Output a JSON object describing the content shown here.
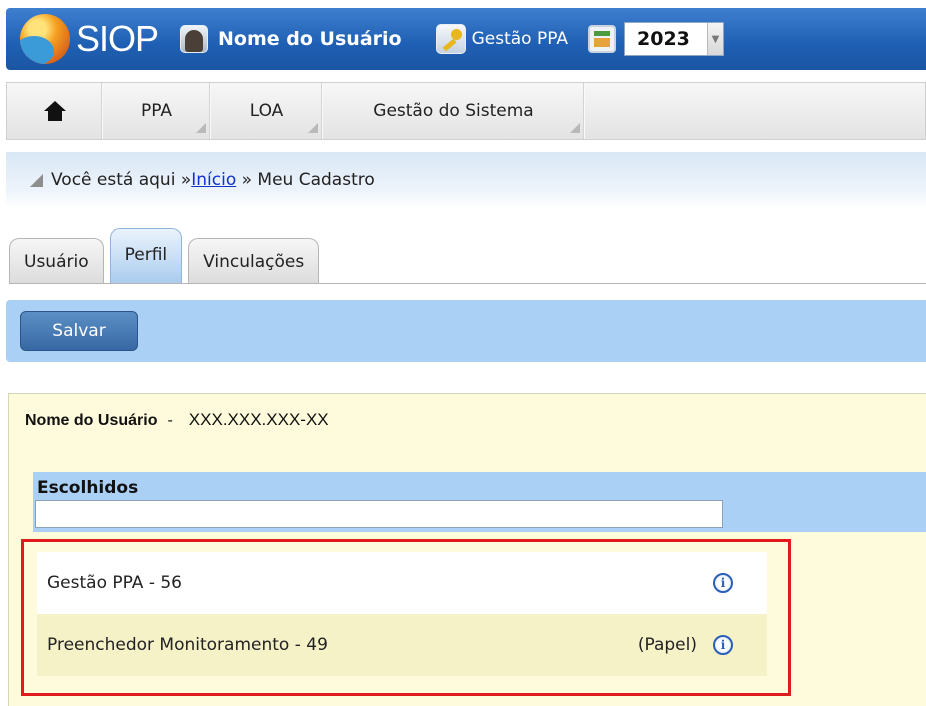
{
  "app": {
    "logo_text": "SIOP",
    "user_name": "Nome do Usuário",
    "module_label": "Gestão PPA",
    "year": "2023"
  },
  "menu": {
    "items": [
      {
        "label": "PPA"
      },
      {
        "label": "LOA"
      },
      {
        "label": "Gestão do Sistema"
      }
    ]
  },
  "breadcrumb": {
    "prefix": "Você está aqui »",
    "link": "Início",
    "current": " » Meu Cadastro"
  },
  "tabs": [
    {
      "label": "Usuário",
      "active": false
    },
    {
      "label": "Perfil",
      "active": true
    },
    {
      "label": "Vinculações",
      "active": false
    }
  ],
  "actions": {
    "save_label": "Salvar"
  },
  "profile": {
    "user_name": "Nome do Usuário",
    "separator": "-",
    "cpf": "XXX.XXX.XXX-XX",
    "chosen_title": "Escolhidos",
    "chosen_filter_value": "",
    "entries": [
      {
        "label": "Gestão PPA - 56",
        "role": ""
      },
      {
        "label": "Preenchedor Monitoramento - 49",
        "role": "(Papel)"
      }
    ]
  },
  "colors": {
    "topbar": "#1f5fb3",
    "action_bar": "#abd0f5",
    "content_bg": "#fdfbdc",
    "highlight": "#e01b1b",
    "link": "#1033cc"
  }
}
